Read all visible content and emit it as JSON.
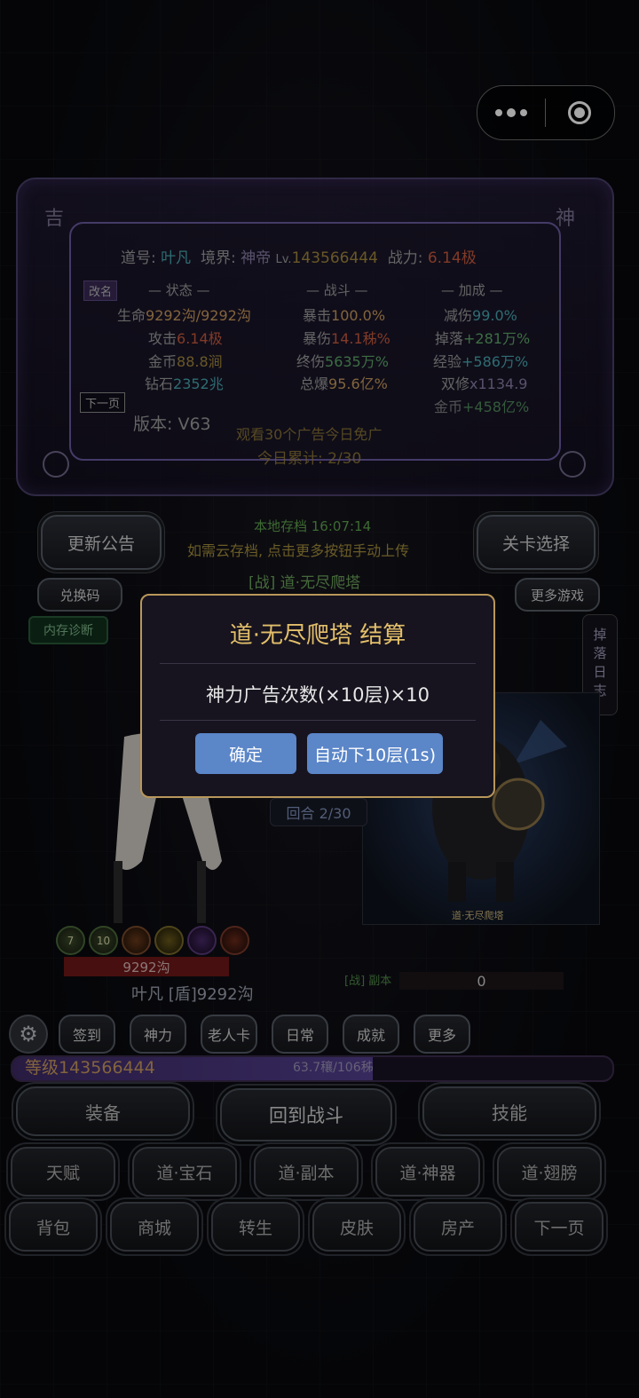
{
  "header": {
    "menu_icon": "more-dots-icon",
    "close_icon": "target-circle-icon"
  },
  "panel": {
    "corner_left": "吉",
    "corner_right": "神",
    "info": {
      "dao_label": "道号:",
      "dao_value": "叶凡",
      "realm_label": "境界:",
      "realm_value": "神帝",
      "lv_label": "Lv.",
      "lv_value": "143566444",
      "power_label": "战力:",
      "power_value": "6.14极"
    },
    "rename_btn": "改名",
    "next_page_btn": "下一页",
    "col_headers": [
      "— 状态 —",
      "— 战斗 —",
      "— 加成 —"
    ],
    "status": [
      {
        "label": "生命",
        "value": "9292沟/9292沟"
      },
      {
        "label": "攻击",
        "value": "6.14极"
      },
      {
        "label": "金币",
        "value": "88.8涧"
      },
      {
        "label": "钻石",
        "value": "2352兆"
      }
    ],
    "battle": [
      {
        "label": "暴击",
        "value": "100.0%"
      },
      {
        "label": "暴伤",
        "value": "14.1秭%"
      },
      {
        "label": "终伤",
        "value": "5635万%"
      },
      {
        "label": "总爆",
        "value": "95.6亿%"
      }
    ],
    "bonus": [
      {
        "label": "减伤",
        "value": "99.0%"
      },
      {
        "label": "掉落",
        "value": "+281万%"
      },
      {
        "label": "经验",
        "value": "+586万%"
      },
      {
        "label": "双修",
        "value": "x1134.9"
      },
      {
        "label": "金币",
        "value": "+458亿%"
      }
    ],
    "version": "版本: V63",
    "ad_line1": "观看30个广告今日免广",
    "ad_line2": "今日累计: 2/30"
  },
  "save": {
    "line1": "本地存档 16:07:14",
    "line2": "如需云存档, 点击更多按钮手动上传",
    "battle_name": "[战] 道·无尽爬塔"
  },
  "buttons": {
    "update_notice": "更新公告",
    "level_select": "关卡选择",
    "redeem": "兑换码",
    "more_games": "更多游戏",
    "mem_diag": "内存诊断"
  },
  "side_tab": "掉落日志",
  "modal": {
    "title": "道·无尽爬塔 结算",
    "message": "神力广告次数(×10层)×10",
    "confirm": "确定",
    "auto": "自动下10层(1s)"
  },
  "battle": {
    "round": "回合 2/30",
    "boss_caption": "道·无尽爬塔",
    "skill_badges": [
      "7",
      "10",
      "",
      "",
      "",
      ""
    ],
    "hp_text": "9292沟",
    "player_line": "叶凡 [盾]9292沟",
    "enemy_label": "[战] 副本",
    "enemy_hp": "0"
  },
  "quick_row": [
    "签到",
    "神力",
    "老人卡",
    "日常",
    "成就",
    "更多"
  ],
  "level": {
    "label": "等级143566444",
    "exp_text": "63.7穰/106秭",
    "fill": 0.6
  },
  "main_row": [
    "装备",
    "回到战斗",
    "技能"
  ],
  "grid_row1": [
    "天赋",
    "道·宝石",
    "道·副本",
    "道·神器",
    "道·翅膀"
  ],
  "grid_row2": [
    "背包",
    "商城",
    "转生",
    "皮肤",
    "房产",
    "下一页"
  ]
}
